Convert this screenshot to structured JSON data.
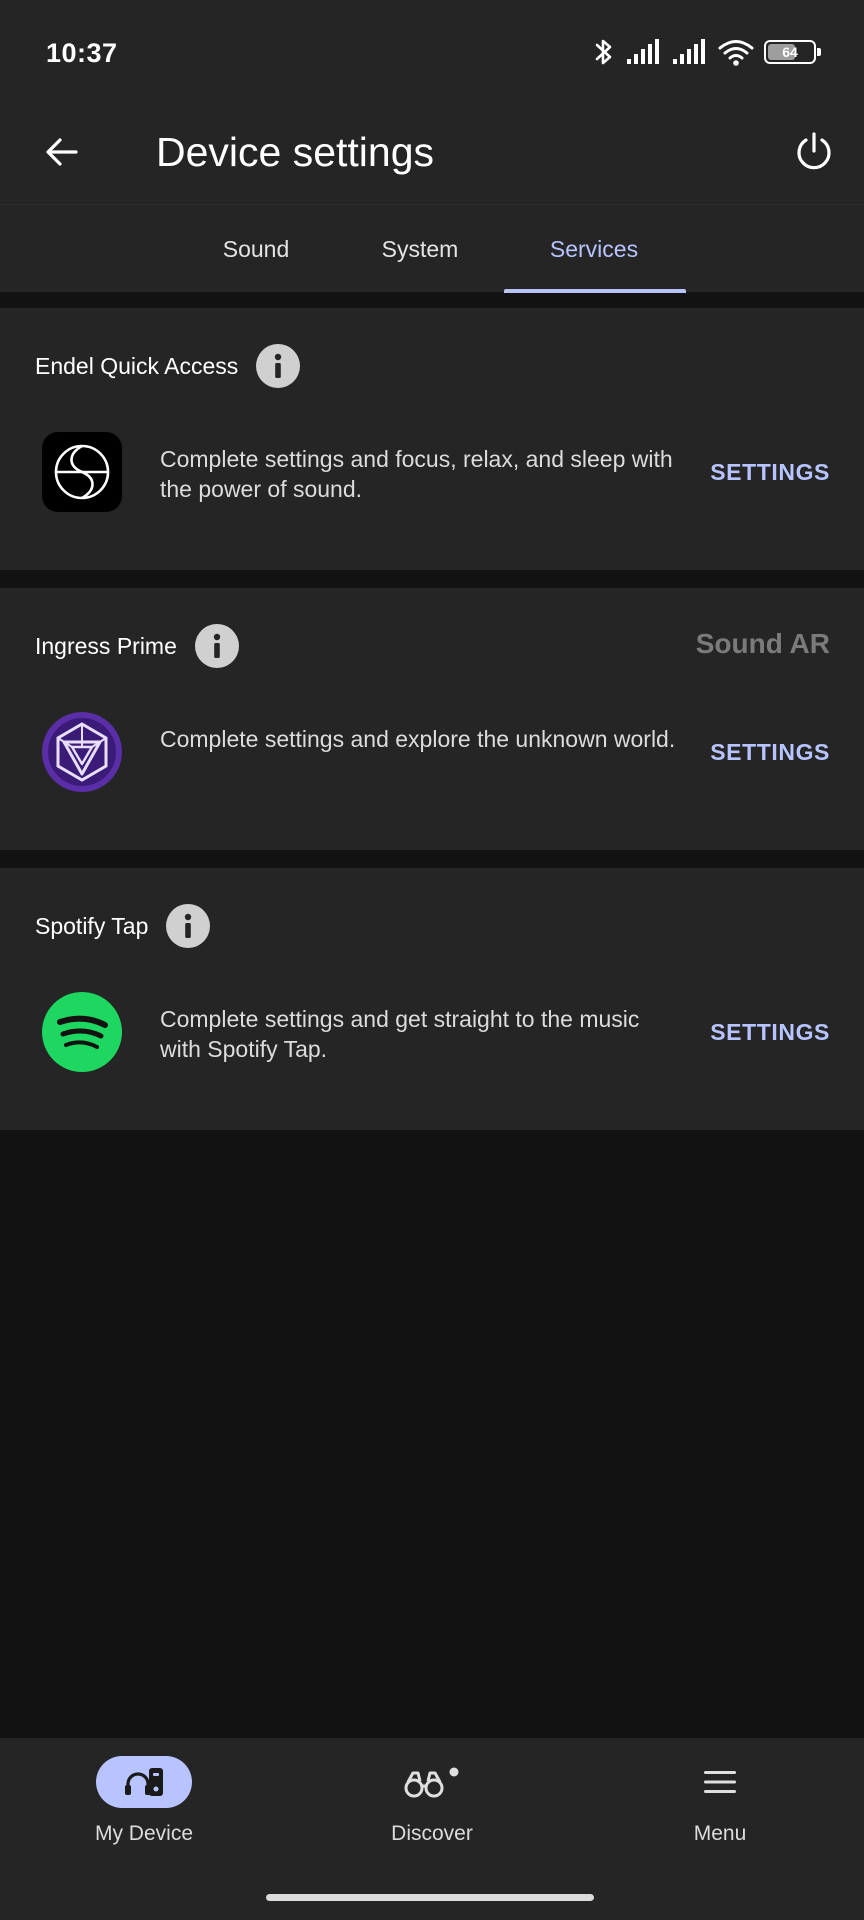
{
  "status_bar": {
    "time": "10:37",
    "battery_level": 64,
    "battery_label": "64",
    "icons": [
      "bluetooth-icon",
      "signal-icon",
      "signal-icon",
      "wifi-icon",
      "battery-icon"
    ]
  },
  "app_bar": {
    "title": "Device settings",
    "back_icon": "arrow-left-icon",
    "power_icon": "power-icon"
  },
  "tabs": [
    {
      "label": "Sound",
      "active": false
    },
    {
      "label": "System",
      "active": false
    },
    {
      "label": "Services",
      "active": true
    }
  ],
  "services": [
    {
      "title": "Endel Quick Access",
      "badge": "",
      "description": "Complete settings and focus, relax, and sleep with the power of sound.",
      "action": "SETTINGS",
      "icon": "endel-logo-icon"
    },
    {
      "title": "Ingress Prime",
      "badge": "Sound AR",
      "description": "Complete settings and explore the unknown world.",
      "action": "SETTINGS",
      "icon": "ingress-logo-icon"
    },
    {
      "title": "Spotify Tap",
      "badge": "",
      "description": "Complete settings and get straight to the music with Spotify Tap.",
      "action": "SETTINGS",
      "icon": "spotify-logo-icon"
    }
  ],
  "bottom_nav": [
    {
      "label": "My Device",
      "icon": "device-icon",
      "active": true
    },
    {
      "label": "Discover",
      "icon": "binoculars-icon",
      "active": false
    },
    {
      "label": "Menu",
      "icon": "menu-icon",
      "active": false
    }
  ],
  "colors": {
    "accent": "#b7c4ff",
    "surface": "#252525",
    "background": "#121212",
    "spotify_green": "#1ed760",
    "ingress_purple": "#5a2ea6"
  }
}
